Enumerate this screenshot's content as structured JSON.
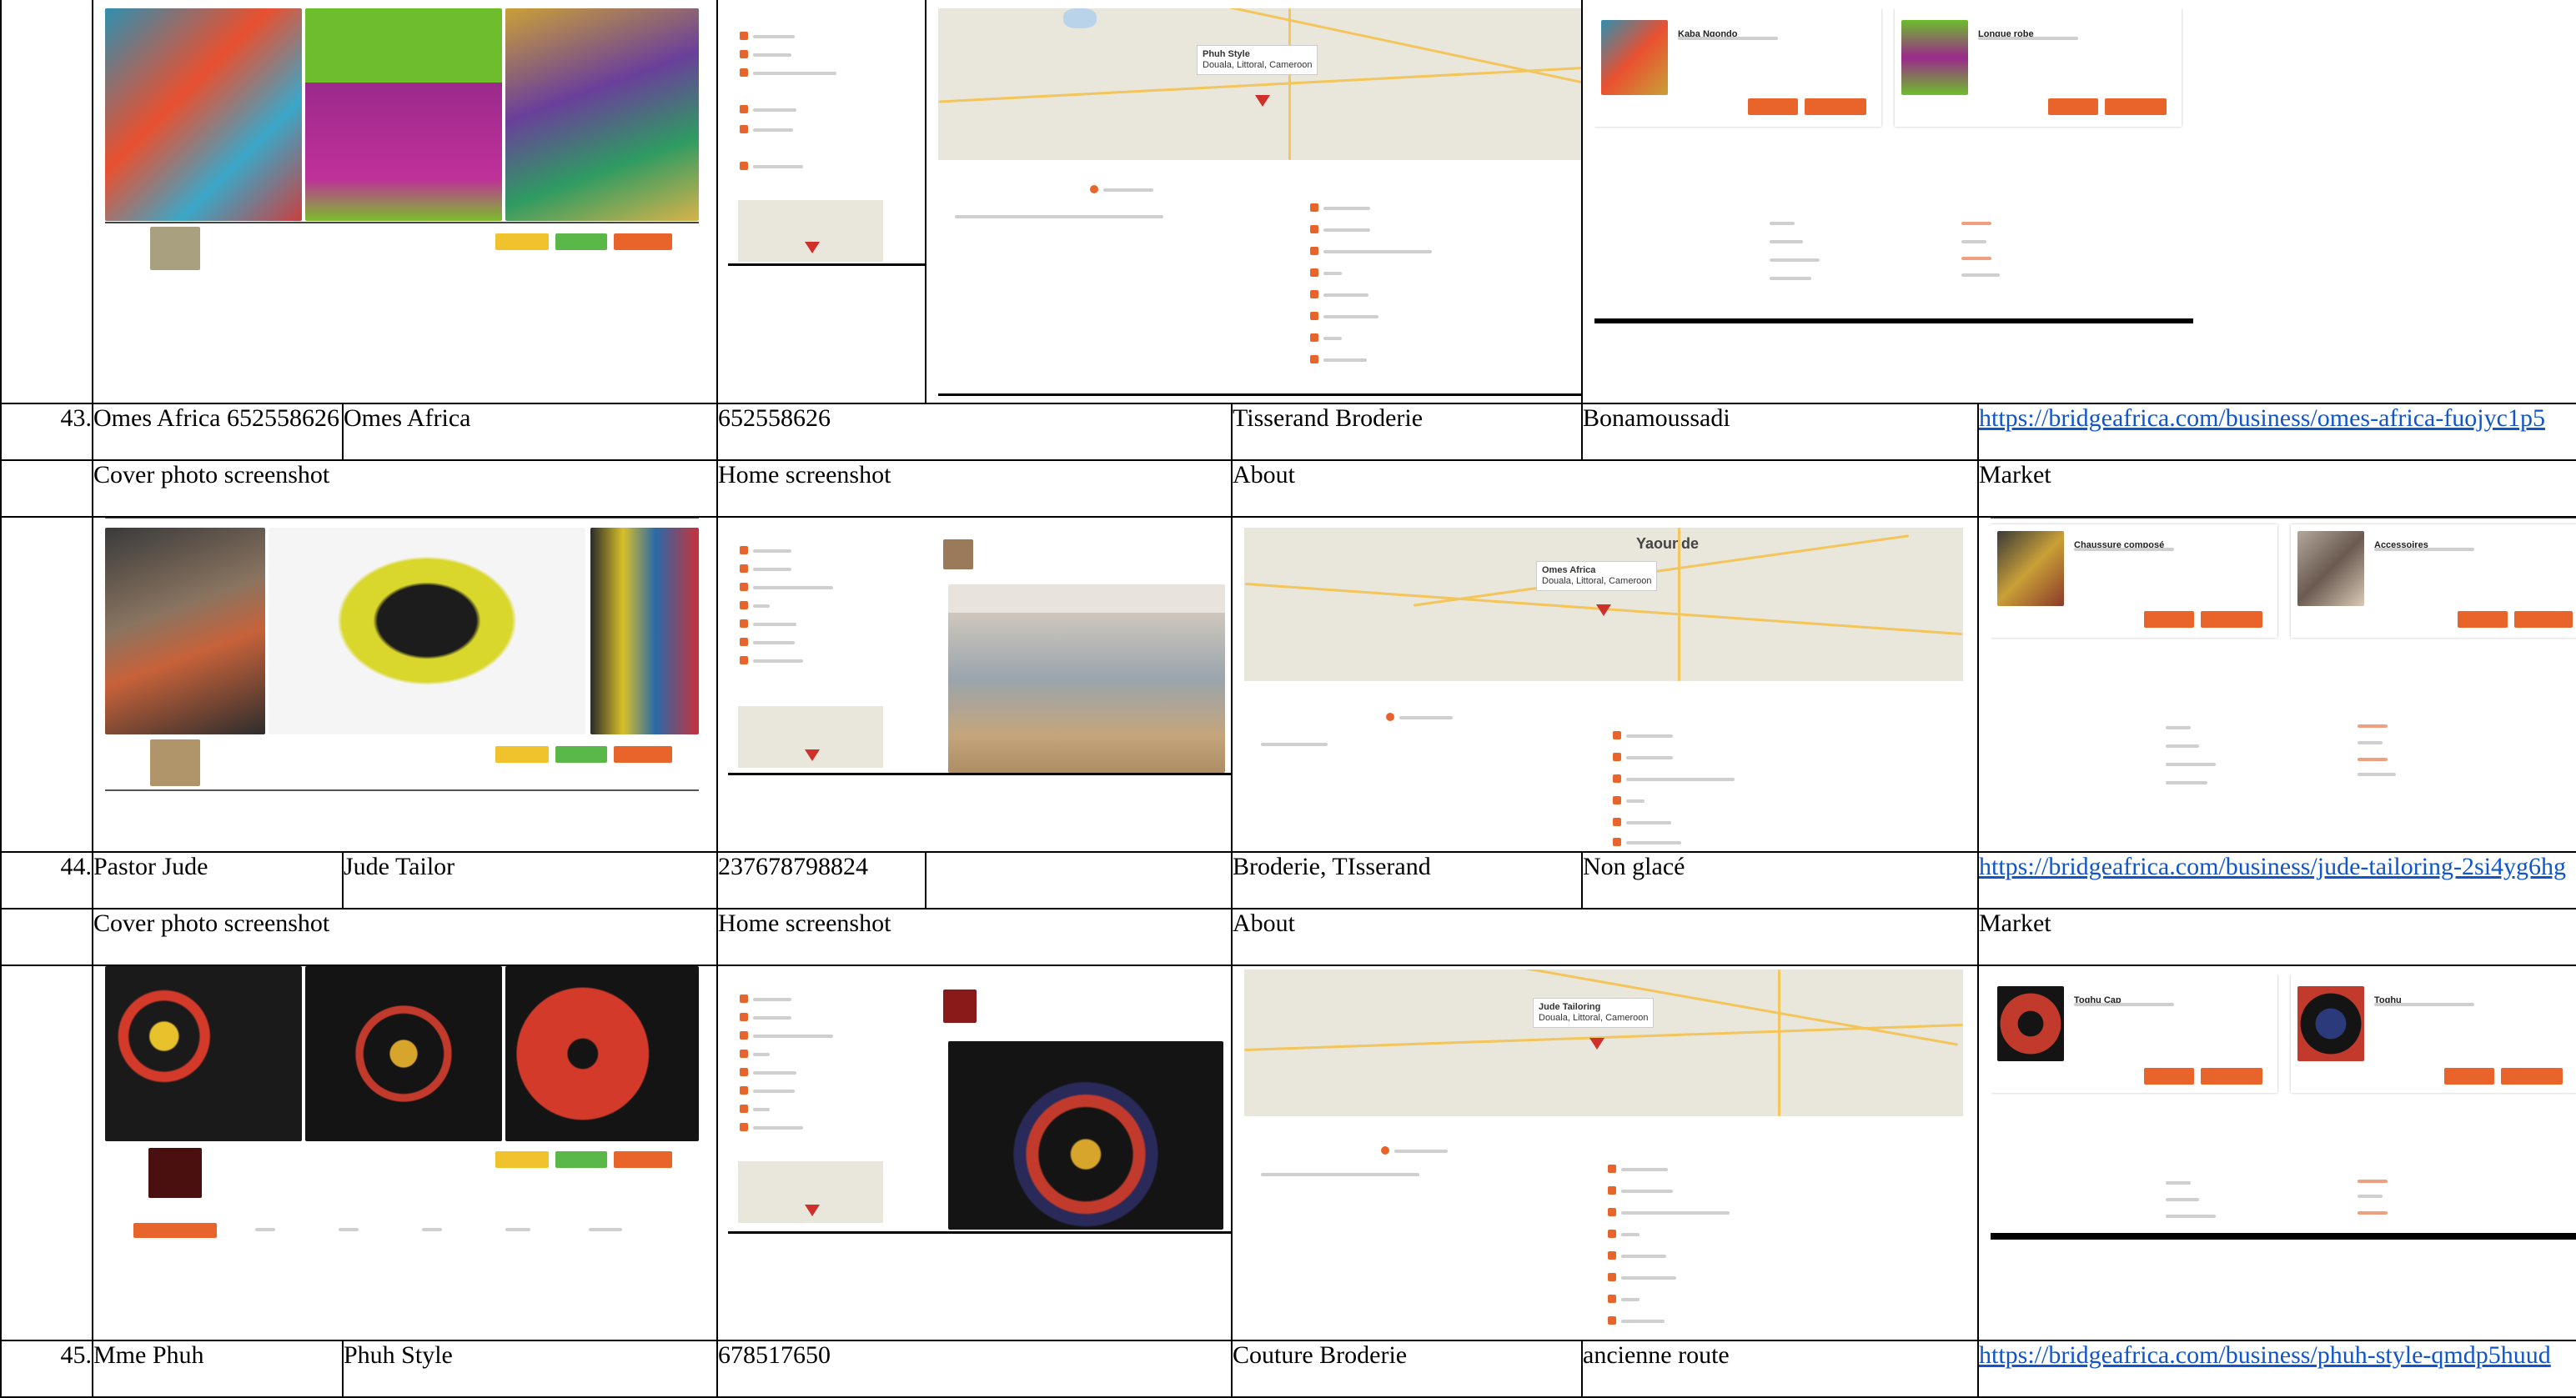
{
  "rows": [
    {
      "num": "43.",
      "contact": "Omes Africa 652558626",
      "business": "Omes Africa",
      "phone": "652558626",
      "activity": "Tisserand Broderie",
      "location": "Bonamoussadi",
      "url": "https://bridgeafrica.com/business/omes-africa-fuojyc1p5",
      "labels": {
        "cover": "Cover photo screenshot",
        "home": "Home screenshot",
        "about": "About",
        "market": "Market"
      },
      "map": {
        "city": "Yaounde",
        "popup_name": "Omes Africa",
        "popup_addr": "Douala, Littoral, Cameroon"
      },
      "products": [
        {
          "name": "Chaussure composé"
        },
        {
          "name": "Accessoires"
        }
      ]
    },
    {
      "num": "44.",
      "contact": "Pastor Jude",
      "business": "Jude Tailor",
      "phone": "237678798824",
      "activity": "Broderie, TIsserand",
      "location": "Non glacé",
      "url": "https://bridgeafrica.com/business/jude-tailoring-2si4yg6hg",
      "labels": {
        "cover": "Cover photo screenshot",
        "home": "Home screenshot",
        "about": "About",
        "market": "Market"
      },
      "map": {
        "popup_name": "Jude Tailoring",
        "popup_addr": "Douala, Littoral, Cameroon"
      },
      "products": [
        {
          "name": "Toghu Cap"
        },
        {
          "name": "Toghu"
        }
      ]
    },
    {
      "num": "45.",
      "contact": "Mme Phuh",
      "business": "Phuh Style",
      "phone": "678517650",
      "activity": "Couture Broderie",
      "location": "ancienne route",
      "url": "https://bridgeafrica.com/business/phuh-style-qmdp5huud"
    }
  ],
  "top": {
    "map": {
      "popup_name": "Phuh Style",
      "popup_addr": "Douala, Littoral, Cameroon"
    },
    "products": [
      {
        "name": "Kaba Ngondo"
      },
      {
        "name": "Longue robe"
      }
    ]
  },
  "colors": {
    "accent": "#e8642a",
    "green": "#59b847",
    "yellow": "#f0c22c",
    "link": "#1155cc"
  }
}
